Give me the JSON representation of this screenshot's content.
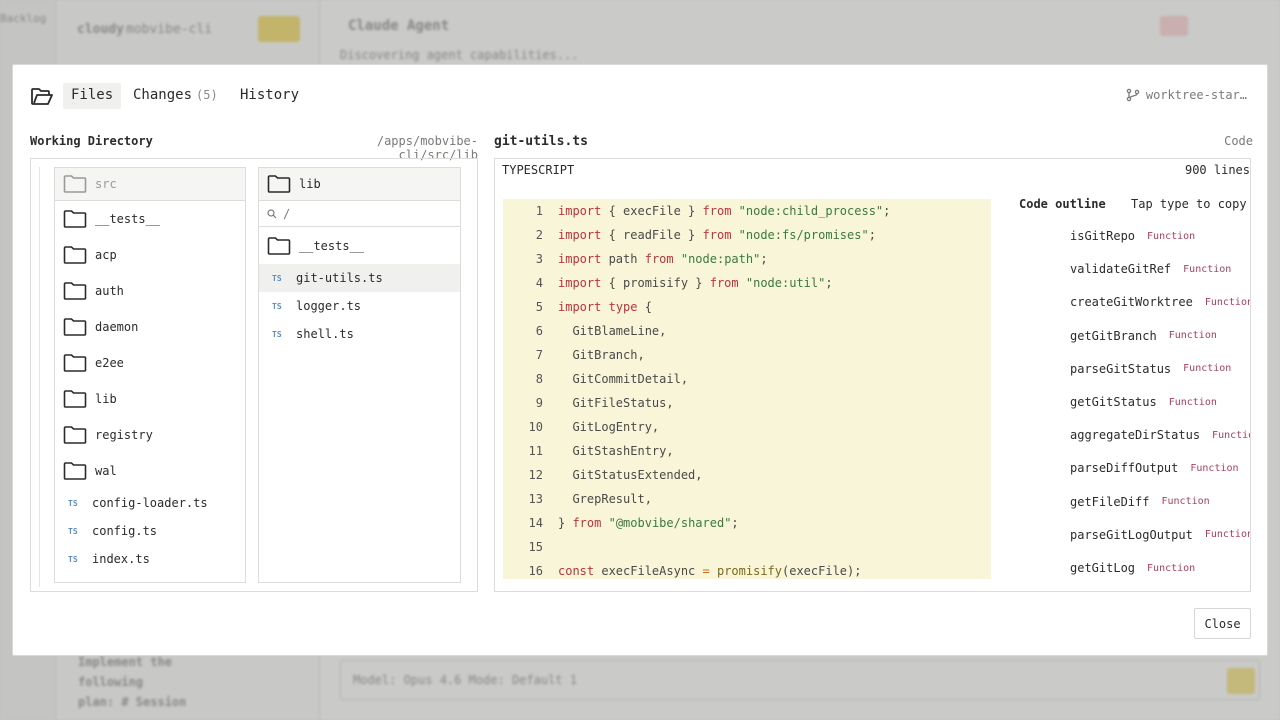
{
  "background": {
    "left_top": "Backlog",
    "sidebar_title": "cloudy",
    "sidebar_subtitle": "mobvibe-cli",
    "main_title": "Claude Agent",
    "main_subtitle": "Discovering agent capabilities...",
    "side_text": [
      "Implement the",
      "following",
      "plan: # Session"
    ],
    "input_placeholder": "Model: Opus 4.6   Mode: Default 1"
  },
  "modal": {
    "tabs": [
      {
        "label": "Files",
        "active": true
      },
      {
        "label": "Changes",
        "count": "(5)"
      },
      {
        "label": "History"
      }
    ],
    "branch": "worktree-star…",
    "working_directory_label": "Working Directory",
    "working_directory_path": "/apps/mobvibe-cli/src/lib",
    "column1": {
      "header": "src",
      "items": [
        {
          "name": "__tests__",
          "type": "folder"
        },
        {
          "name": "acp",
          "type": "folder"
        },
        {
          "name": "auth",
          "type": "folder"
        },
        {
          "name": "daemon",
          "type": "folder"
        },
        {
          "name": "e2ee",
          "type": "folder"
        },
        {
          "name": "lib",
          "type": "folder"
        },
        {
          "name": "registry",
          "type": "folder"
        },
        {
          "name": "wal",
          "type": "folder"
        },
        {
          "name": "config-loader.ts",
          "type": "ts"
        },
        {
          "name": "config.ts",
          "type": "ts"
        },
        {
          "name": "index.ts",
          "type": "ts"
        }
      ]
    },
    "column2": {
      "header": "lib",
      "search_value": "/",
      "items": [
        {
          "name": "__tests__",
          "type": "folder"
        },
        {
          "name": "git-utils.ts",
          "type": "ts",
          "selected": true
        },
        {
          "name": "logger.ts",
          "type": "ts"
        },
        {
          "name": "shell.ts",
          "type": "ts"
        }
      ]
    },
    "ts_badge": "TS",
    "file": {
      "name": "git-utils.ts",
      "view_label": "Code",
      "language": "TYPESCRIPT",
      "line_count": "900 lines"
    },
    "code_lines": [
      {
        "n": "1",
        "parts": [
          [
            "kw",
            "import"
          ],
          [
            "t",
            " { execFile } "
          ],
          [
            "kw",
            "from"
          ],
          [
            "t",
            " "
          ],
          [
            "str",
            "\"node:child_process\""
          ],
          [
            "t",
            ";"
          ]
        ]
      },
      {
        "n": "2",
        "parts": [
          [
            "kw",
            "import"
          ],
          [
            "t",
            " { readFile } "
          ],
          [
            "kw",
            "from"
          ],
          [
            "t",
            " "
          ],
          [
            "str",
            "\"node:fs/promises\""
          ],
          [
            "t",
            ";"
          ]
        ]
      },
      {
        "n": "3",
        "parts": [
          [
            "kw",
            "import"
          ],
          [
            "t",
            " path "
          ],
          [
            "kw",
            "from"
          ],
          [
            "t",
            " "
          ],
          [
            "str",
            "\"node:path\""
          ],
          [
            "t",
            ";"
          ]
        ]
      },
      {
        "n": "4",
        "parts": [
          [
            "kw",
            "import"
          ],
          [
            "t",
            " { promisify } "
          ],
          [
            "kw",
            "from"
          ],
          [
            "t",
            " "
          ],
          [
            "str",
            "\"node:util\""
          ],
          [
            "t",
            ";"
          ]
        ]
      },
      {
        "n": "5",
        "parts": [
          [
            "kw",
            "import"
          ],
          [
            "t",
            " "
          ],
          [
            "kw",
            "type"
          ],
          [
            "t",
            " {"
          ]
        ]
      },
      {
        "n": "6",
        "parts": [
          [
            "t",
            "  GitBlameLine,"
          ]
        ]
      },
      {
        "n": "7",
        "parts": [
          [
            "t",
            "  GitBranch,"
          ]
        ]
      },
      {
        "n": "8",
        "parts": [
          [
            "t",
            "  GitCommitDetail,"
          ]
        ]
      },
      {
        "n": "9",
        "parts": [
          [
            "t",
            "  GitFileStatus,"
          ]
        ]
      },
      {
        "n": "10",
        "parts": [
          [
            "t",
            "  GitLogEntry,"
          ]
        ]
      },
      {
        "n": "11",
        "parts": [
          [
            "t",
            "  GitStashEntry,"
          ]
        ]
      },
      {
        "n": "12",
        "parts": [
          [
            "t",
            "  GitStatusExtended,"
          ]
        ]
      },
      {
        "n": "13",
        "parts": [
          [
            "t",
            "  GrepResult,"
          ]
        ]
      },
      {
        "n": "14",
        "parts": [
          [
            "t",
            "} "
          ],
          [
            "kw",
            "from"
          ],
          [
            "t",
            " "
          ],
          [
            "str",
            "\"@mobvibe/shared\""
          ],
          [
            "t",
            ";"
          ]
        ]
      },
      {
        "n": "15",
        "parts": []
      },
      {
        "n": "16",
        "parts": [
          [
            "kw",
            "const"
          ],
          [
            "t",
            " execFileAsync "
          ],
          [
            "op",
            "="
          ],
          [
            "t",
            " "
          ],
          [
            "fn",
            "promisify"
          ],
          [
            "t",
            "(execFile);"
          ]
        ]
      }
    ],
    "outline": {
      "title": "Code outline",
      "hint": "Tap type to copy",
      "items": [
        {
          "name": "isGitRepo",
          "type": "Function"
        },
        {
          "name": "validateGitRef",
          "type": "Function"
        },
        {
          "name": "createGitWorktree",
          "type": "Function"
        },
        {
          "name": "getGitBranch",
          "type": "Function"
        },
        {
          "name": "parseGitStatus",
          "type": "Function"
        },
        {
          "name": "getGitStatus",
          "type": "Function"
        },
        {
          "name": "aggregateDirStatus",
          "type": "Function"
        },
        {
          "name": "parseDiffOutput",
          "type": "Function"
        },
        {
          "name": "getFileDiff",
          "type": "Function"
        },
        {
          "name": "parseGitLogOutput",
          "type": "Function"
        },
        {
          "name": "getGitLog",
          "type": "Function"
        }
      ]
    },
    "close_label": "Close"
  }
}
